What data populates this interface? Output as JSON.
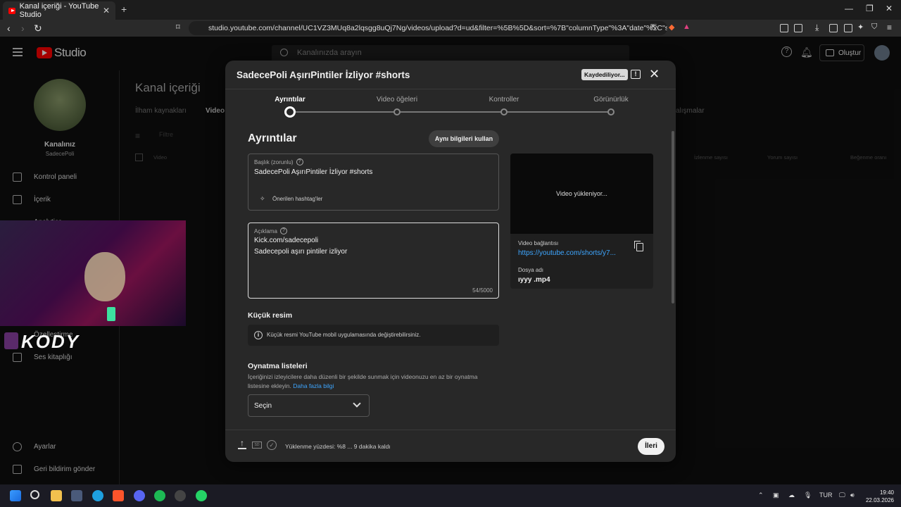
{
  "browser": {
    "tab_title": "Kanal içeriği - YouTube Studio",
    "url": "studio.youtube.com/channel/UC1VZ3MUq8a2lqsgg8uQj7Ng/videos/upload?d=ud&filter=%5B%5D&sort=%7B\"columnType\"%3A\"date\"%2C\"sortOrd..."
  },
  "studio": {
    "logo_text": "Studio",
    "search_placeholder": "Kanalınızda arayın",
    "create_label": "Oluştur",
    "page_title": "Kanal içeriği",
    "tabs": [
      "İlham kaynakları",
      "Video"
    ],
    "filter_placeholder": "Filtre",
    "bg_columns": [
      "Video",
      "İzlenme sayısı",
      "Yorum sayısı",
      "Beğenme oranı"
    ],
    "bg_partial_text": "alışmalar",
    "channel": {
      "label": "Kanalınız",
      "name": "SadecePoli"
    },
    "sidebar": {
      "dashboard": "Kontrol paneli",
      "content": "İçerik",
      "analytics": "Analytics",
      "customization": "Özelleştirme",
      "audio_library": "Ses kitaplığı",
      "settings": "Ayarlar",
      "feedback": "Geri bildirim gönder"
    }
  },
  "overlay": {
    "streamer_tag": "KODY"
  },
  "modal": {
    "title": "SadecePoli AşırıPintiler İzliyor #shorts",
    "saving_badge": "Kaydediliyor...",
    "steps": [
      {
        "label": "Ayrıntılar",
        "active": true
      },
      {
        "label": "Video öğeleri",
        "active": false
      },
      {
        "label": "Kontroller",
        "active": false
      },
      {
        "label": "Görünürlük",
        "active": false
      }
    ],
    "section_heading": "Ayrıntılar",
    "reuse_button": "Aynı bilgileri kullan",
    "title_field": {
      "label": "Başlık (zorunlu)",
      "value": "SadecePoli AşırıPintiler İzliyor #shorts",
      "hashtag_hint": "Önerilen hashtag'ler"
    },
    "description_field": {
      "label": "Açıklama",
      "line1": "Kick.com/sadecepoli",
      "line2": "Sadecepoli aşırı pintiler izliyor",
      "char_count": "54/5000"
    },
    "preview": {
      "status": "Video yükleniyor...",
      "link_label": "Video bağlantısı",
      "link_value": "https://youtube.com/shorts/y7...",
      "file_label": "Dosya adı",
      "file_value": "ıyyy .mp4"
    },
    "thumbnail": {
      "heading": "Küçük resim",
      "info": "Küçük resmi YouTube mobil uygulamasında değiştirebilirsiniz."
    },
    "playlists": {
      "heading": "Oynatma listeleri",
      "description_a": "İçeriğinizi izleyicilere daha düzenli bir şekilde sunmak için videonuzu en az bir oynatma",
      "description_b": "listesine ekleyin.",
      "learn_more": "Daha fazla bilgi",
      "select_value": "Seçin"
    },
    "footer": {
      "sd_badge": "SD",
      "upload_status": "Yüklenme yüzdesi: %8 ... 9 dakika kaldı",
      "next_button": "İleri"
    }
  },
  "taskbar": {
    "lang": "TUR",
    "time": "19:40",
    "date": "22.03.2026"
  },
  "colors": {
    "brand_red": "#ff0000",
    "link_blue": "#3ea6ff",
    "modal_bg": "#282828"
  }
}
